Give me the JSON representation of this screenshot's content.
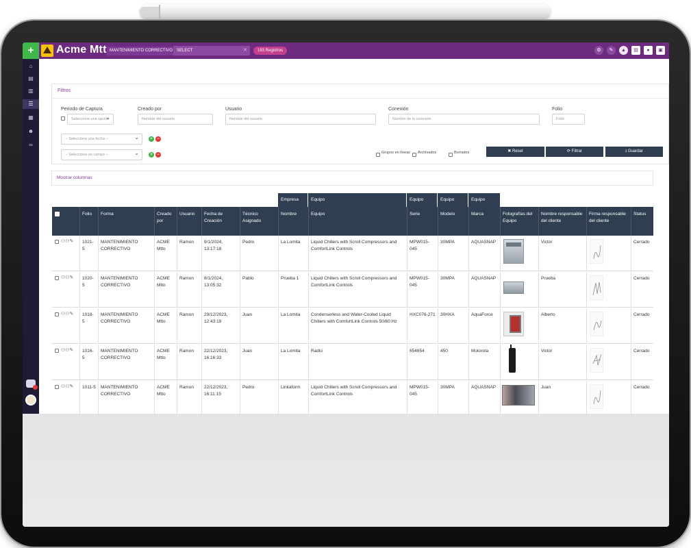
{
  "app": {
    "title": "Acme Mtto",
    "module": "MANTENIMIENTO CORRECTIVO",
    "select_value": "SELECT",
    "records_badge": "193 Registros"
  },
  "filters": {
    "title": "Filtros",
    "periodo_label": "Periodo de Captura",
    "periodo_placeholder": "Seleccione una opción",
    "creado_label": "Creado por",
    "creado_placeholder": "Nombre del usuario",
    "usuario_label": "Usuario",
    "usuario_placeholder": "Nombre del usuario",
    "conexion_label": "Conexión",
    "conexion_placeholder": "Nombre de la conexión",
    "folio_label": "Folio",
    "folio_placeholder": "Folio",
    "fecha_select": "-- Selecciona una fecha --",
    "campo_select": "-- Selecciona un campo --",
    "grupos_label": "Grupos en líneas",
    "archivados_label": "Archivados",
    "borrados_label": "Borrados",
    "reset_label": "✖ Reset",
    "filtrar_label": "⟳ Filtrar",
    "guardar_label": "⭳ Guardar"
  },
  "columns_panel": {
    "label": "Mostrar columnas"
  },
  "table": {
    "groups": [
      "Empresa",
      "Equipo",
      "Equipo",
      "Equipo",
      "Equipo"
    ],
    "headers": [
      "Folio",
      "Forma",
      "Creado por",
      "Usuario",
      "Fecha de Creación",
      "Técnico Asignado",
      "Nombre",
      "Equipo",
      "Serie",
      "Modelo",
      "Marca",
      "Fotografías del Equipo",
      "Nombre responsable del cliente",
      "Firma responsable del cliente",
      "Status"
    ],
    "rows": [
      {
        "folio": "1021-5",
        "forma": "MANTENIMIENTO CORRECTIVO",
        "creado": "ACME Mtto",
        "usuario": "Ramon",
        "fecha": "9/1/2024, 13:17:18",
        "tecnico": "Pedro",
        "empresa": "La Lomita",
        "equipo": "Liquid Chillers with Scroll Compressors and ComfortLink Controls",
        "serie": "MPW015-045",
        "modelo": "30MPA",
        "marca": "AQUASNAP",
        "responsable": "Victor",
        "status": "Cerrado"
      },
      {
        "folio": "1020-5",
        "forma": "MANTENIMIENTO CORRECTIVO",
        "creado": "ACME Mtto",
        "usuario": "Ramon",
        "fecha": "8/1/2024, 13:05:32",
        "tecnico": "Pablo",
        "empresa": "Prueba 1",
        "equipo": "Liquid Chillers with Scroll Compressors and ComfortLink Controls",
        "serie": "MPW015-045",
        "modelo": "30MPA",
        "marca": "AQUASNAP",
        "responsable": "Prueba",
        "status": "Cerrado"
      },
      {
        "folio": "1018-5",
        "forma": "MANTENIMIENTO CORRECTIVO",
        "creado": "ACME Mtto",
        "usuario": "Ramon",
        "fecha": "29/12/2023, 12:43:19",
        "tecnico": "Juan",
        "empresa": "La Lomita",
        "equipo": "Condenserless and Water-Cooled Liquid Chillers with ComfortLink Controls 50/60 Hz",
        "serie": "HXC076-271",
        "modelo": "30HXA",
        "marca": "AquaForce",
        "responsable": "Alberto",
        "status": "Cerrado"
      },
      {
        "folio": "1016-5",
        "forma": "MANTENIMIENTO CORRECTIVO",
        "creado": "ACME Mtto",
        "usuario": "Ramon",
        "fecha": "22/12/2023, 16:16:33",
        "tecnico": "Juan",
        "empresa": "La Lomita",
        "equipo": "Radio",
        "serie": "654654",
        "modelo": "450",
        "marca": "Motorola",
        "responsable": "Victor",
        "status": "Cerrado"
      },
      {
        "folio": "1011-5",
        "forma": "MANTENIMIENTO CORRECTIVO",
        "creado": "ACME Mtto",
        "usuario": "Ramon",
        "fecha": "22/12/2023, 16:11:15",
        "tecnico": "Pedro",
        "empresa": "Linkaform",
        "equipo": "Liquid Chillers with Scroll Compressors and ComfortLink Controls",
        "serie": "MPW015-045",
        "modelo": "30MPA",
        "marca": "AQUASNAP",
        "responsable": "Juan",
        "status": "Cerrado"
      }
    ]
  },
  "colors": {
    "topbar": "#6c2b7e",
    "sidebar": "#1d1b35",
    "table_header": "#2f3e50",
    "add": "#3fb74b",
    "delete": "#e53935"
  }
}
